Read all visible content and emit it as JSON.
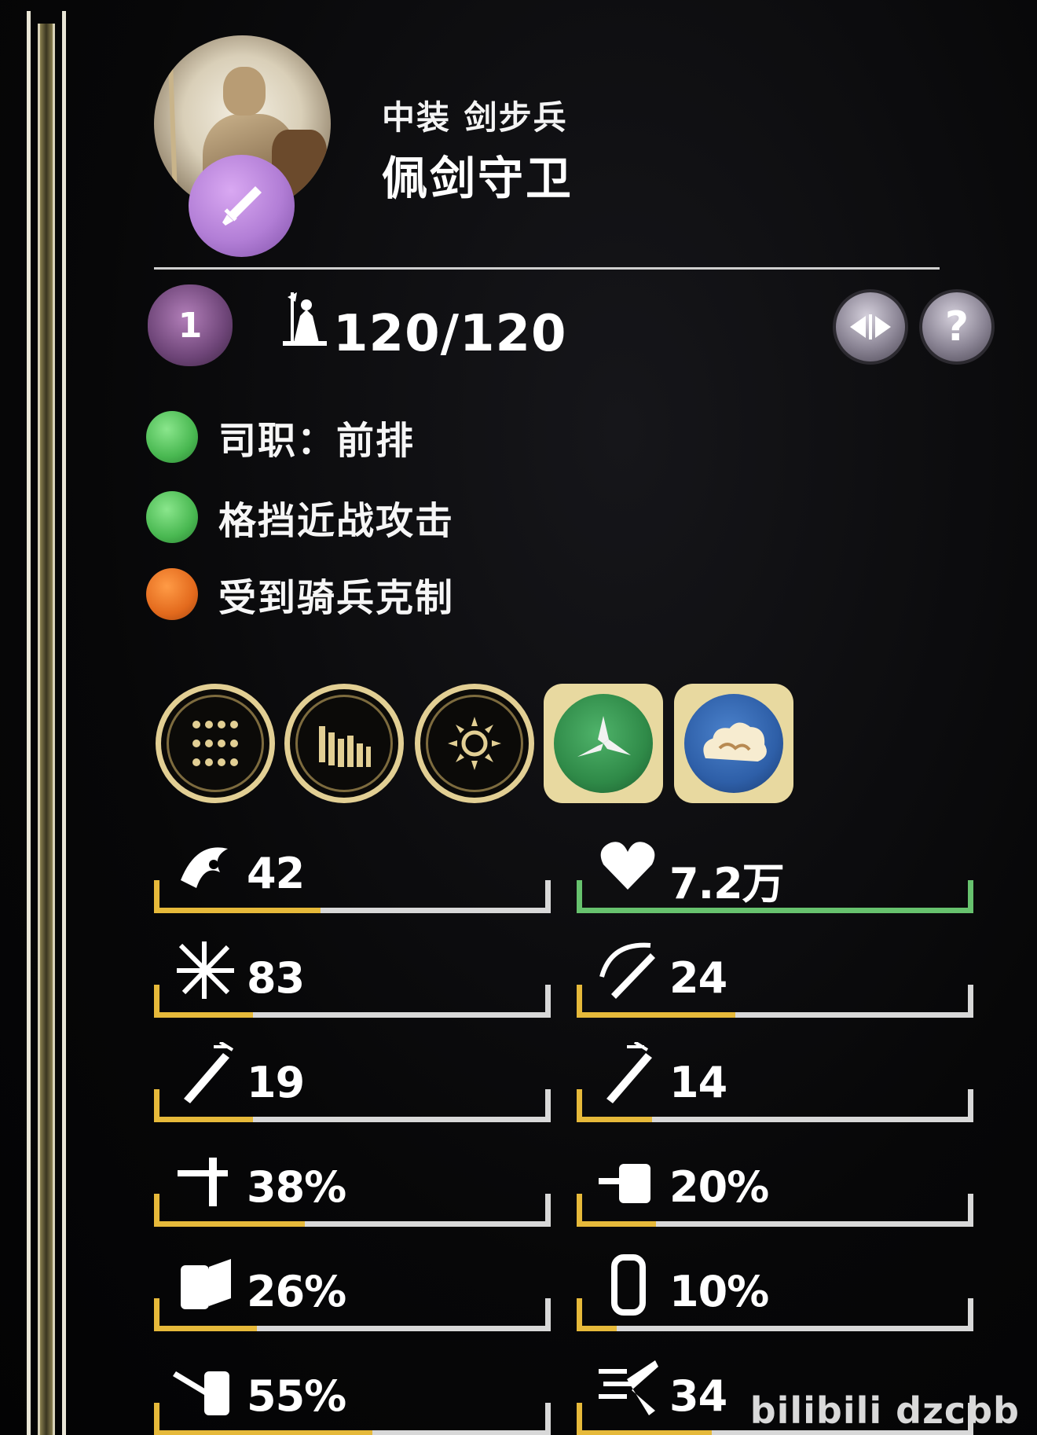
{
  "unit": {
    "subtitle": "中装 剑步兵",
    "name": "佩剑守卫",
    "class_icon": "sword-icon",
    "class_color": "#b27ed6"
  },
  "level": "1",
  "troops": {
    "icon": "troop-icon",
    "count": "120/120"
  },
  "buttons": {
    "compare_icon": "compare-arrows-icon",
    "help_label": "?"
  },
  "traits": [
    {
      "label": "司职：前排",
      "color": "green"
    },
    {
      "label": "格挡近战攻击",
      "color": "green"
    },
    {
      "label": "受到骑兵克制",
      "color": "orange"
    }
  ],
  "abilities": [
    {
      "icon": "formation-icon",
      "style": "ring"
    },
    {
      "icon": "wall-icon",
      "style": "ring"
    },
    {
      "icon": "sun-icon",
      "style": "ring"
    },
    {
      "icon": "shuriken-icon",
      "style": "special",
      "color": "#2f8a48"
    },
    {
      "icon": "cloud-icon",
      "style": "special",
      "color": "#2e5fa8"
    }
  ],
  "stats": [
    {
      "icon": "morale-icon",
      "value": "42",
      "fill": 0.42
    },
    {
      "icon": "heart-icon",
      "value": "7.2万",
      "fill": 1.0,
      "type": "hp"
    },
    {
      "icon": "burst-icon",
      "value": "83",
      "fill": 0.25
    },
    {
      "icon": "speed-icon",
      "value": "24",
      "fill": 0.4
    },
    {
      "icon": "sword-attack-icon",
      "value": "19",
      "fill": 0.25
    },
    {
      "icon": "sword-defense-icon",
      "value": "14",
      "fill": 0.19
    },
    {
      "icon": "weapon-damage-icon",
      "value": "38%",
      "fill": 0.38
    },
    {
      "icon": "armor-pierce-icon",
      "value": "20%",
      "fill": 0.2
    },
    {
      "icon": "block-icon",
      "value": "26%",
      "fill": 0.26
    },
    {
      "icon": "shield-icon",
      "value": "10%",
      "fill": 0.1
    },
    {
      "icon": "charge-icon",
      "value": "55%",
      "fill": 0.55
    },
    {
      "icon": "charge-bonus-icon",
      "value": "34",
      "fill": 0.34
    }
  ],
  "watermark": "bilibili dzcbb",
  "colors": {
    "bar_fill": "#e6b93a",
    "hp_bar": "#67c26e",
    "ring_gold": "#e2cf94"
  }
}
